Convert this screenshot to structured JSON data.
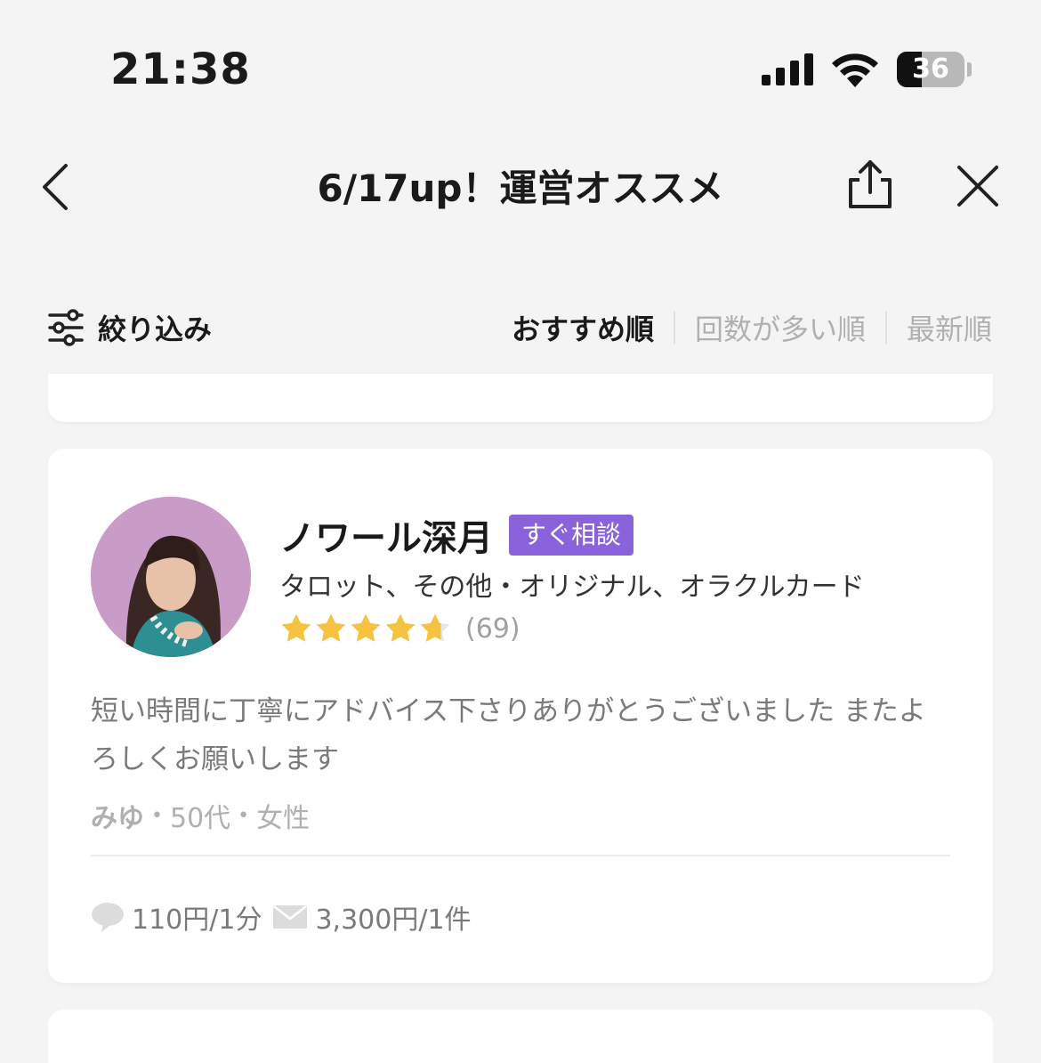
{
  "status_bar": {
    "time": "21:38",
    "battery": "36"
  },
  "nav": {
    "title": "6/17up！運営オススメ"
  },
  "filter": {
    "label": "絞り込み"
  },
  "sort": {
    "options": [
      "おすすめ順",
      "回数が多い順",
      "最新順"
    ],
    "active": 0
  },
  "card": {
    "name": "ノワール深月",
    "badge": "すぐ相談",
    "genres": "タロット、その他・オリジナル、オラクルカード",
    "rating_count": "(69)",
    "rating_value": 4.7,
    "review": "短い時間に丁寧にアドバイス下さりありがとうございました またよろしくお願いします",
    "reviewer": {
      "name": "みゆ",
      "age": "50代",
      "gender": "女性"
    },
    "prices": {
      "chat": "110円/1分",
      "mail": "3,300円/1件"
    }
  },
  "colors": {
    "accent": "#8a63dc",
    "star": "#f5c242",
    "avatar_bg": "#c99cc8"
  }
}
